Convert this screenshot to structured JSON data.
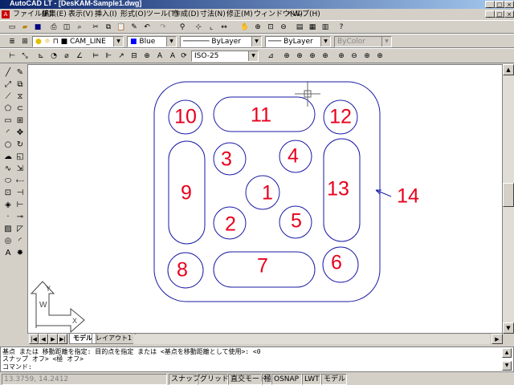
{
  "window": {
    "title": "AutoCAD LT - [DesKAM-Sample1.dwg]",
    "min_glyph": "_",
    "max_glyph": "□",
    "close_glyph": "×"
  },
  "menu": {
    "items": [
      "ファイル(F)",
      "編集(E)",
      "表示(V)",
      "挿入(I)",
      "形式(O)",
      "ツール(T)",
      "作成(D)",
      "寸法(N)",
      "修正(M)",
      "ウィンドウ(W)",
      "ヘルプ(H)"
    ]
  },
  "layer_bar": {
    "layer_name": "CAM_LINE",
    "color": "Blue",
    "linetype": "ByLayer",
    "lineweight": "ByLayer",
    "plotstyle": "ByColor"
  },
  "dim_bar": {
    "dimstyle": "ISO-25"
  },
  "drawing": {
    "numbers": [
      "1",
      "2",
      "3",
      "4",
      "5",
      "6",
      "7",
      "8",
      "9",
      "10",
      "11",
      "12",
      "13",
      "14"
    ],
    "label_color": "#e8001c",
    "geometry_color": "#1a1aa6"
  },
  "tabs": {
    "model": "モデル",
    "layout": "レイアウト1"
  },
  "command": {
    "line1": "基点 または 移動距離を指定: 目的点を指定 または <基点を移動距離として使用>: <0",
    "line2": "スナップ オフ>  <極 オフ>",
    "line3": "コマンド:"
  },
  "status": {
    "coords": "13.3759, 14.2412",
    "snap": "スナップ",
    "grid": "グリッド",
    "ortho": "直交モード",
    "polar": "極",
    "osnap": "OSNAP",
    "lwt": "LWT",
    "model": "モデル"
  }
}
